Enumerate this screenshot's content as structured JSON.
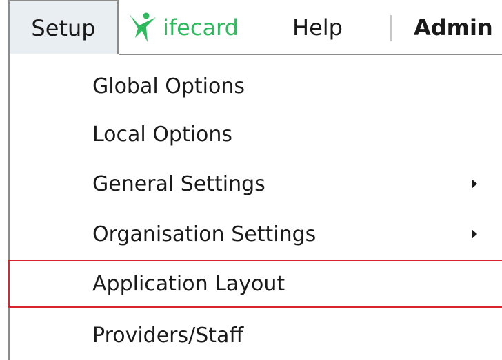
{
  "menubar": {
    "setup_label": "Setup",
    "lifecard_label": "ifecard",
    "lifecard_color": "#2dbb5d",
    "help_label": "Help",
    "admin_label": "Admin"
  },
  "dropdown": {
    "items": [
      {
        "label": "Global Options",
        "submenu": false
      },
      {
        "label": "Local Options",
        "submenu": false
      },
      {
        "label": "General Settings",
        "submenu": true
      },
      {
        "label": "Organisation Settings",
        "submenu": true
      },
      {
        "label": "Application Layout",
        "submenu": false,
        "highlighted": true
      },
      {
        "label": "Providers/Staff",
        "submenu": false
      }
    ],
    "highlight_color": "#d9232d"
  },
  "icons": {
    "lifecard": "lifecard-logo-icon",
    "submenu": "submenu-arrow-icon"
  }
}
